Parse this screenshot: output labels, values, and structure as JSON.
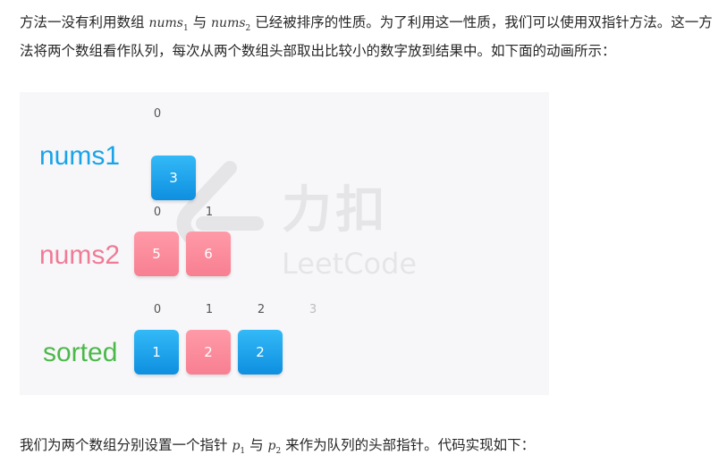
{
  "intro": {
    "t1": "方法一没有利用数组 ",
    "m1_base": "nums",
    "m1_sub": "1",
    "t2": " 与 ",
    "m2_base": "nums",
    "m2_sub": "2",
    "t3": " 已经被排序的性质。为了利用这一性质，我们可以使用双指针方法。这一方法将两个数组看作队列，每次从两个数组头部取出比较小的数字放到结果中。如下面的动画所示："
  },
  "figure": {
    "watermark_cn": "力扣",
    "watermark_en": "LeetCode",
    "nums1": {
      "label": "nums1",
      "indices": [
        "0"
      ],
      "values": [
        "3"
      ]
    },
    "nums2": {
      "label": "nums2",
      "indices": [
        "0",
        "1"
      ],
      "values": [
        "5",
        "6"
      ]
    },
    "sorted": {
      "label": "sorted",
      "indices": [
        "0",
        "1",
        "2",
        "3"
      ],
      "values": [
        "1",
        "2",
        "2"
      ]
    },
    "colors": {
      "blue": "#1aa3e8",
      "pink": "#f77f91",
      "green": "#4cb84a"
    }
  },
  "outro": {
    "t1": "我们为两个数组分别设置一个指针 ",
    "m1_base": "p",
    "m1_sub": "1",
    "t2": " 与 ",
    "m2_base": "p",
    "m2_sub": "2",
    "t3": " 来作为队列的头部指针。代码实现如下："
  }
}
